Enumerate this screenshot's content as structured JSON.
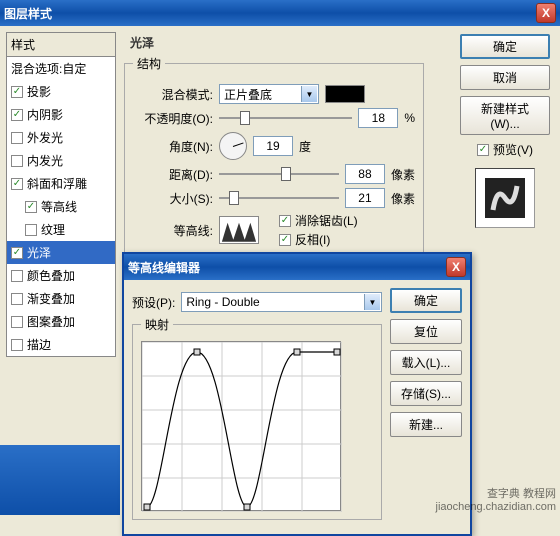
{
  "dialog": {
    "title": "图层样式",
    "close_x": "X"
  },
  "styles": {
    "header": "样式",
    "blend_options": "混合选项:自定",
    "items": [
      {
        "label": "投影",
        "checked": true,
        "indent": false
      },
      {
        "label": "内阴影",
        "checked": true,
        "indent": false
      },
      {
        "label": "外发光",
        "checked": false,
        "indent": false
      },
      {
        "label": "内发光",
        "checked": false,
        "indent": false
      },
      {
        "label": "斜面和浮雕",
        "checked": true,
        "indent": false
      },
      {
        "label": "等高线",
        "checked": true,
        "indent": true
      },
      {
        "label": "纹理",
        "checked": false,
        "indent": true
      },
      {
        "label": "光泽",
        "checked": true,
        "indent": false,
        "selected": true
      },
      {
        "label": "颜色叠加",
        "checked": false,
        "indent": false
      },
      {
        "label": "渐变叠加",
        "checked": false,
        "indent": false
      },
      {
        "label": "图案叠加",
        "checked": false,
        "indent": false
      },
      {
        "label": "描边",
        "checked": false,
        "indent": false
      }
    ]
  },
  "satin": {
    "section_title": "光泽",
    "structure_title": "结构",
    "blend_mode_label": "混合模式:",
    "blend_mode_value": "正片叠底",
    "opacity_label": "不透明度(O):",
    "opacity_value": "18",
    "opacity_unit": "%",
    "angle_label": "角度(N):",
    "angle_value": "19",
    "angle_unit": "度",
    "distance_label": "距离(D):",
    "distance_value": "88",
    "distance_unit": "像素",
    "size_label": "大小(S):",
    "size_value": "21",
    "size_unit": "像素",
    "contour_label": "等高线:",
    "antialias_label": "消除锯齿(L)",
    "invert_label": "反相(I)"
  },
  "right": {
    "ok": "确定",
    "cancel": "取消",
    "new_style": "新建样式(W)...",
    "preview": "预览(V)"
  },
  "contour_editor": {
    "title": "等高线编辑器",
    "preset_label": "预设(P):",
    "preset_value": "Ring - Double",
    "mapping_title": "映射",
    "ok": "确定",
    "reset": "复位",
    "load": "载入(L)...",
    "save": "存储(S)...",
    "new": "新建..."
  },
  "watermark": "查字典 教程网\njiaocheng.chazidian.com"
}
